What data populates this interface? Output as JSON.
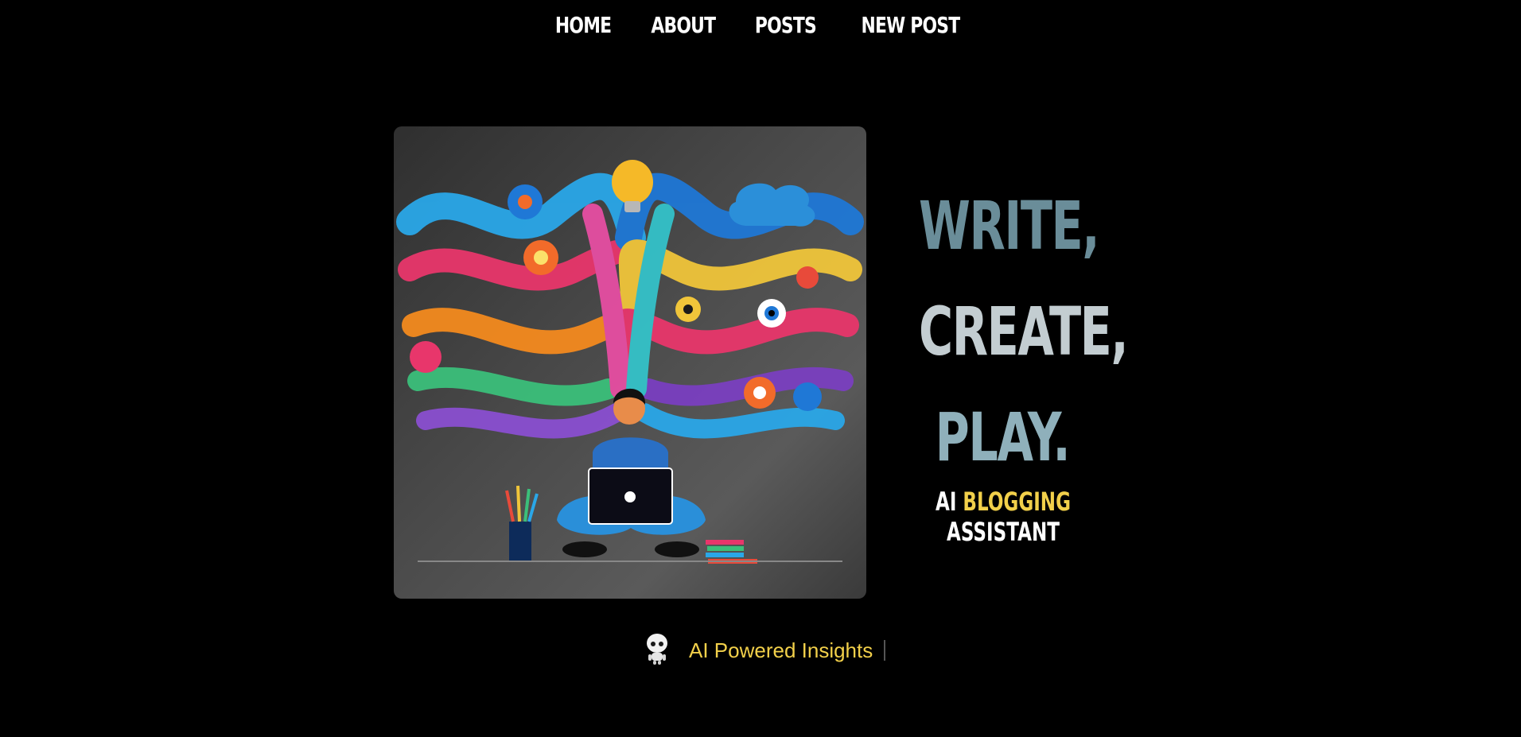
{
  "nav": {
    "items": [
      {
        "label": "HOME"
      },
      {
        "label": "ABOUT"
      },
      {
        "label": "POSTS"
      },
      {
        "label": "NEW POST"
      }
    ]
  },
  "hero": {
    "headline": [
      "WRITE,",
      "CREATE,",
      "PLAY."
    ],
    "tagline": {
      "part1": "AI",
      "part2": "BLOGGING",
      "part3": "ASSISTANT"
    },
    "accent_color": "#f2d04a"
  },
  "typer": {
    "icon": "robot-icon",
    "text": "AI Powered Insights"
  }
}
